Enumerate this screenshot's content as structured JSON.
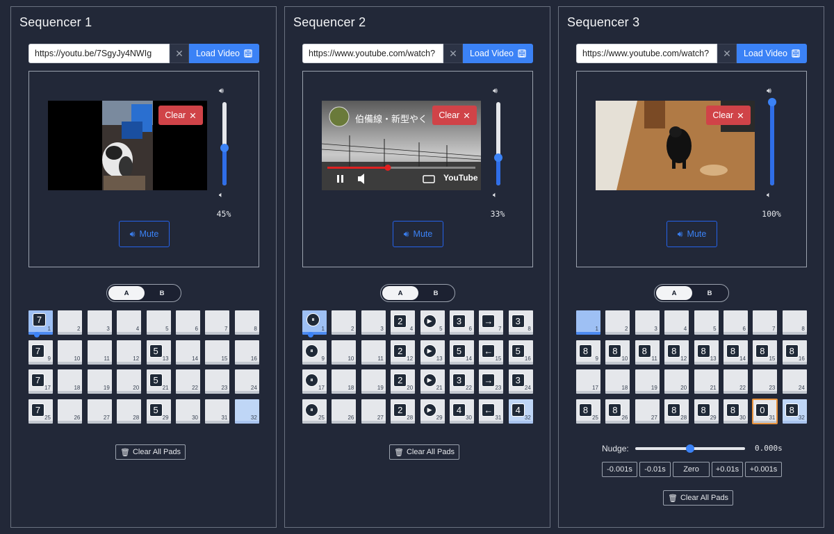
{
  "sequencers": [
    {
      "title": "Sequencer 1",
      "url": "https://youtu.be/7SgyJy4NWIg",
      "load_label": "Load Video",
      "clear_label": "Clear",
      "volume_pct": "45%",
      "volume": 0.45,
      "mute_label": "Mute",
      "ab": [
        "A",
        "B"
      ],
      "ab_active": "A",
      "clear_all_label": "Clear All Pads",
      "pads": [
        {
          "n": "1",
          "badge": "7",
          "state": "current"
        },
        {
          "n": "2"
        },
        {
          "n": "3"
        },
        {
          "n": "4"
        },
        {
          "n": "5"
        },
        {
          "n": "6"
        },
        {
          "n": "7"
        },
        {
          "n": "8"
        },
        {
          "n": "9",
          "badge": "7"
        },
        {
          "n": "10"
        },
        {
          "n": "11"
        },
        {
          "n": "12"
        },
        {
          "n": "13",
          "badge": "5"
        },
        {
          "n": "14"
        },
        {
          "n": "15"
        },
        {
          "n": "16"
        },
        {
          "n": "17",
          "badge": "7"
        },
        {
          "n": "18"
        },
        {
          "n": "19"
        },
        {
          "n": "20"
        },
        {
          "n": "21",
          "badge": "5"
        },
        {
          "n": "22"
        },
        {
          "n": "23"
        },
        {
          "n": "24"
        },
        {
          "n": "25",
          "badge": "7"
        },
        {
          "n": "26"
        },
        {
          "n": "27"
        },
        {
          "n": "28"
        },
        {
          "n": "29",
          "badge": "5"
        },
        {
          "n": "30"
        },
        {
          "n": "31"
        },
        {
          "n": "32",
          "state": "active"
        }
      ]
    },
    {
      "title": "Sequencer 2",
      "url": "https://www.youtube.com/watch?",
      "load_label": "Load Video",
      "clear_label": "Clear",
      "video_caption": "伯備線・新型やく",
      "video_brand": "YouTube",
      "volume_pct": "33%",
      "volume": 0.33,
      "mute_label": "Mute",
      "ab": [
        "A",
        "B"
      ],
      "ab_active": "A",
      "clear_all_label": "Clear All Pads",
      "pads": [
        {
          "n": "1",
          "badge": "⏸",
          "round": true,
          "state": "current"
        },
        {
          "n": "2"
        },
        {
          "n": "3"
        },
        {
          "n": "4",
          "badge": "2"
        },
        {
          "n": "5",
          "badge": "▶",
          "round": true
        },
        {
          "n": "6",
          "badge": "3"
        },
        {
          "n": "7",
          "badge": "→"
        },
        {
          "n": "8",
          "badge": "3"
        },
        {
          "n": "9",
          "badge": "⏸",
          "round": true
        },
        {
          "n": "10"
        },
        {
          "n": "11"
        },
        {
          "n": "12",
          "badge": "2"
        },
        {
          "n": "13",
          "badge": "▶",
          "round": true
        },
        {
          "n": "14",
          "badge": "5"
        },
        {
          "n": "15",
          "badge": "←"
        },
        {
          "n": "16",
          "badge": "5"
        },
        {
          "n": "17",
          "badge": "⏸",
          "round": true
        },
        {
          "n": "18"
        },
        {
          "n": "19"
        },
        {
          "n": "20",
          "badge": "2"
        },
        {
          "n": "21",
          "badge": "▶",
          "round": true
        },
        {
          "n": "22",
          "badge": "3"
        },
        {
          "n": "23",
          "badge": "→"
        },
        {
          "n": "24",
          "badge": "3"
        },
        {
          "n": "25",
          "badge": "⏸",
          "round": true
        },
        {
          "n": "26"
        },
        {
          "n": "27"
        },
        {
          "n": "28",
          "badge": "2"
        },
        {
          "n": "29",
          "badge": "▶",
          "round": true
        },
        {
          "n": "30",
          "badge": "4"
        },
        {
          "n": "31",
          "badge": "←"
        },
        {
          "n": "32",
          "badge": "4",
          "state": "active"
        }
      ]
    },
    {
      "title": "Sequencer 3",
      "url": "https://www.youtube.com/watch?",
      "load_label": "Load Video",
      "clear_label": "Clear",
      "volume_pct": "100%",
      "volume": 1.0,
      "mute_label": "Mute",
      "ab": [
        "A",
        "B"
      ],
      "ab_active": "A",
      "clear_all_label": "Clear All Pads",
      "nudge_label": "Nudge:",
      "nudge_value": "0.000s",
      "nudge_level": 0.5,
      "nudge_buttons": [
        "-0.001s",
        "-0.01s",
        "Zero",
        "+0.01s",
        "+0.001s"
      ],
      "pads": [
        {
          "n": "1",
          "state": "current"
        },
        {
          "n": "2"
        },
        {
          "n": "3"
        },
        {
          "n": "4"
        },
        {
          "n": "5"
        },
        {
          "n": "6"
        },
        {
          "n": "7"
        },
        {
          "n": "8"
        },
        {
          "n": "9",
          "badge": "8"
        },
        {
          "n": "10",
          "badge": "8"
        },
        {
          "n": "11",
          "badge": "8"
        },
        {
          "n": "12",
          "badge": "8"
        },
        {
          "n": "13",
          "badge": "8"
        },
        {
          "n": "14",
          "badge": "8"
        },
        {
          "n": "15",
          "badge": "8"
        },
        {
          "n": "16",
          "badge": "8"
        },
        {
          "n": "17"
        },
        {
          "n": "18"
        },
        {
          "n": "19"
        },
        {
          "n": "20"
        },
        {
          "n": "21"
        },
        {
          "n": "22"
        },
        {
          "n": "23"
        },
        {
          "n": "24"
        },
        {
          "n": "25",
          "badge": "8"
        },
        {
          "n": "26",
          "badge": "8"
        },
        {
          "n": "27"
        },
        {
          "n": "28",
          "badge": "8"
        },
        {
          "n": "29",
          "badge": "8"
        },
        {
          "n": "30",
          "badge": "8"
        },
        {
          "n": "31",
          "badge": "0",
          "state": "highlight"
        },
        {
          "n": "32",
          "badge": "8",
          "state": "active"
        }
      ]
    }
  ],
  "colors": {
    "accent": "#3b82f6",
    "danger": "#d04348",
    "background": "#222838"
  }
}
